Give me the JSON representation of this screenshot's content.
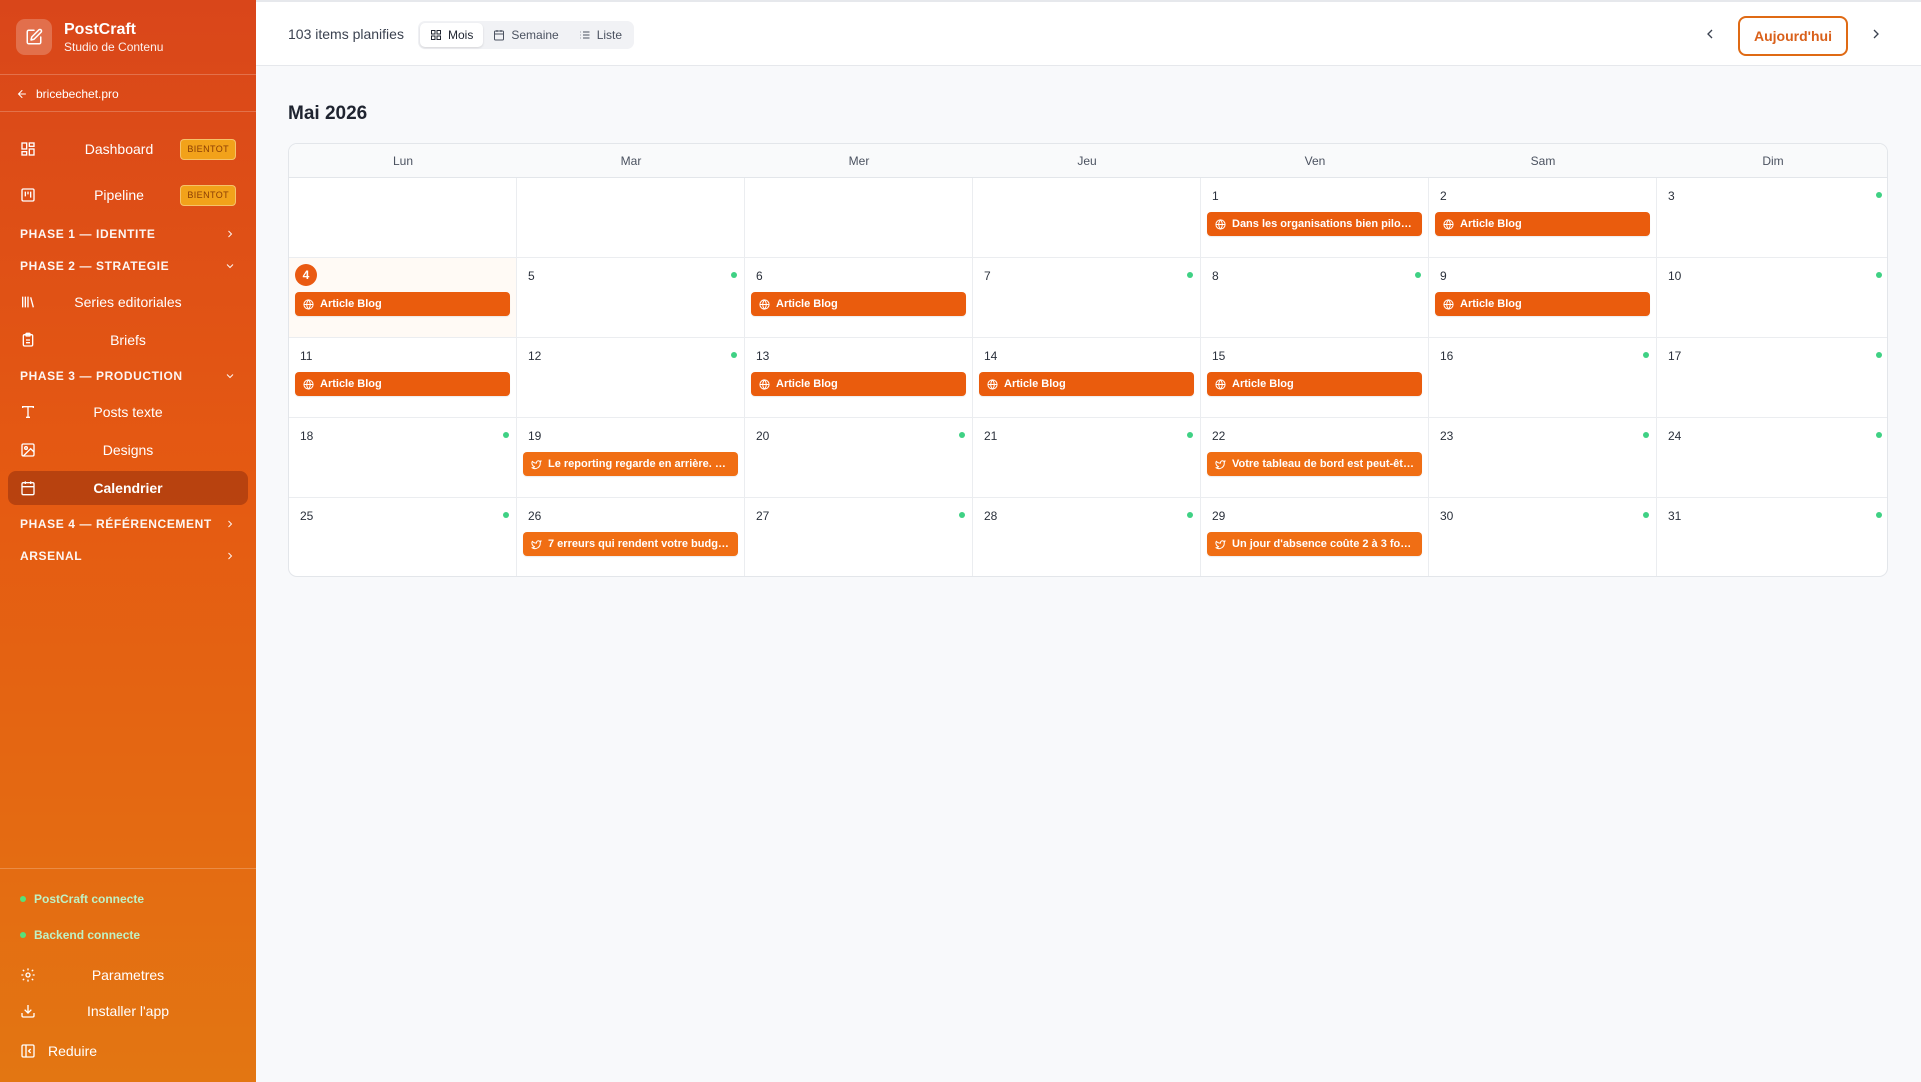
{
  "app": {
    "name": "PostCraft",
    "subtitle": "Studio de Contenu"
  },
  "back_link": "bricebechet.pro",
  "nav": {
    "dashboard": "Dashboard",
    "pipeline": "Pipeline",
    "badge": "BIENTOT",
    "phase1": "PHASE 1 — IDENTITE",
    "phase2": "PHASE 2 — STRATEGIE",
    "series": "Series editoriales",
    "briefs": "Briefs",
    "phase3": "PHASE 3 — PRODUCTION",
    "posts": "Posts texte",
    "designs": "Designs",
    "calendar": "Calendrier",
    "phase4": "PHASE 4 — RÉFÉRENCEMENT",
    "arsenal": "ARSENAL"
  },
  "status": {
    "postcraft": "PostCraft connecte",
    "backend": "Backend connecte"
  },
  "bottom": {
    "settings": "Parametres",
    "install": "Installer l'app",
    "collapse": "Reduire"
  },
  "toolbar": {
    "count": "103 items planifies",
    "views": [
      "Mois",
      "Semaine",
      "Liste"
    ],
    "today": "Aujourd'hui"
  },
  "calendar": {
    "title": "Mai 2026",
    "weekdays": [
      "Lun",
      "Mar",
      "Mer",
      "Jeu",
      "Ven",
      "Sam",
      "Dim"
    ],
    "weeks": [
      [
        "",
        "",
        "",
        "",
        "1",
        "2",
        "3"
      ],
      [
        "4",
        "5",
        "6",
        "7",
        "8",
        "9",
        "10"
      ],
      [
        "11",
        "12",
        "13",
        "14",
        "15",
        "16",
        "17"
      ],
      [
        "18",
        "19",
        "20",
        "21",
        "22",
        "23",
        "24"
      ],
      [
        "25",
        "26",
        "27",
        "28",
        "29",
        "30",
        "31"
      ]
    ],
    "events": {
      "0-4": "Dans les organisations bien piloté...",
      "0-5": "Article Blog",
      "1-0": "Article Blog",
      "1-2": "Article Blog",
      "1-5": "Article Blog",
      "2-0": "Article Blog",
      "2-2": "Article Blog",
      "2-3": "Article Blog",
      "2-4": "Article Blog",
      "3-1": "Le reporting regarde en arrière. Le...",
      "3-4": "Votre tableau de bord est peut-êtr...",
      "4-1": "7 erreurs qui rendent votre budge...",
      "4-4": "Un jour d'absence coûte 2 à 3 fois ..."
    },
    "social_events": [
      "3-1",
      "3-4",
      "4-1",
      "4-4"
    ],
    "dots": [
      "0-6",
      "1-1",
      "1-3",
      "1-4",
      "1-6",
      "2-1",
      "2-5",
      "2-6",
      "3-0",
      "3-2",
      "3-3",
      "3-5",
      "3-6",
      "4-0",
      "4-2",
      "4-3",
      "4-5",
      "4-6"
    ],
    "today": "1-0"
  }
}
